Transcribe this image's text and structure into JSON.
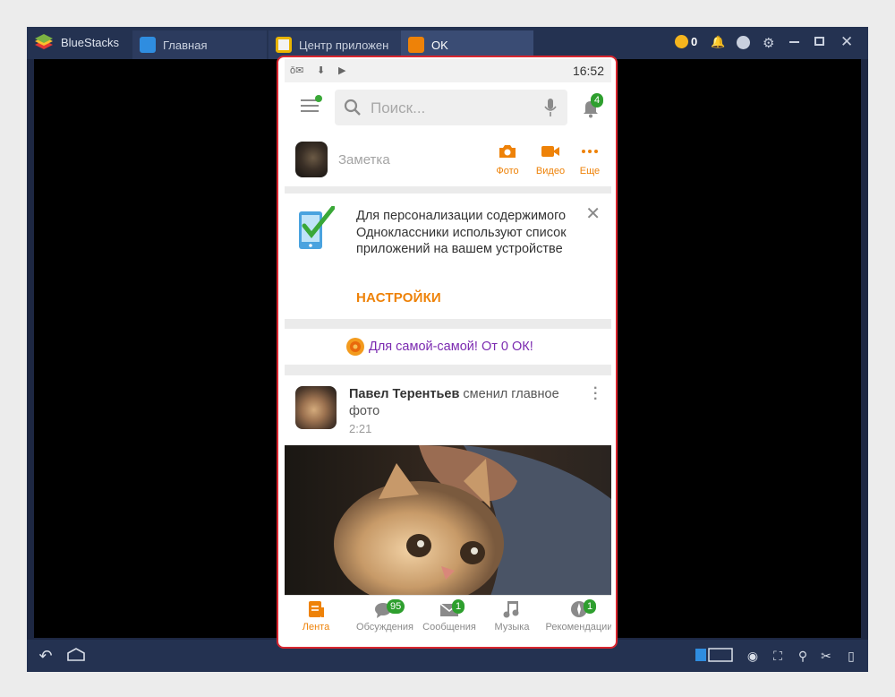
{
  "window": {
    "app_name": "BlueStacks",
    "tabs": [
      {
        "label": "Главная"
      },
      {
        "label": "Центр приложений"
      },
      {
        "label": "OK"
      }
    ],
    "coins": "0"
  },
  "status_bar": {
    "time": "16:52"
  },
  "app_bar": {
    "search_placeholder": "Поиск...",
    "notifications_count": "4"
  },
  "compose": {
    "placeholder": "Заметка",
    "actions": [
      {
        "label": "Фото",
        "icon": "camera-icon"
      },
      {
        "label": "Видео",
        "icon": "video-icon"
      },
      {
        "label": "Еще",
        "icon": "more-dots-icon"
      }
    ]
  },
  "permission_card": {
    "message": "Для персонализации содержимого Одноклассники используют список приложений на вашем устройстве",
    "button": "НАСТРОЙКИ"
  },
  "promo": {
    "text": "Для самой-самой! От 0 ОК!"
  },
  "post": {
    "author": "Павел Терентьев",
    "action": " сменил главное фото",
    "time": "2:21"
  },
  "nav": [
    {
      "label": "Лента",
      "icon": "feed-icon",
      "badge": ""
    },
    {
      "label": "Обсуждения",
      "icon": "discussions-icon",
      "badge": "95"
    },
    {
      "label": "Сообщения",
      "icon": "messages-icon",
      "badge": "1"
    },
    {
      "label": "Музыка",
      "icon": "music-icon",
      "badge": ""
    },
    {
      "label": "Рекомендации",
      "icon": "recommendations-icon",
      "badge": "1"
    }
  ],
  "colors": {
    "accent": "#ee8208",
    "badge": "#2e9f2e",
    "promo": "#7b2ab0",
    "highlight_frame": "#d9262f",
    "window_chrome": "#243251"
  }
}
